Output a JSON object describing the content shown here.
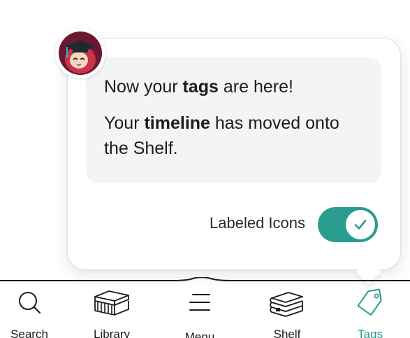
{
  "popover": {
    "line1_prefix": "Now your ",
    "line1_bold": "tags",
    "line1_suffix": " are here!",
    "line2_prefix": "Your ",
    "line2_bold": "timeline",
    "line2_suffix": " has moved onto the Shelf.",
    "toggle_label": "Labeled Icons",
    "toggle_on": true
  },
  "tabs": [
    {
      "id": "search",
      "label": "Search",
      "icon": "search-icon",
      "active": false
    },
    {
      "id": "library",
      "label": "Library",
      "icon": "library-icon",
      "active": false
    },
    {
      "id": "menu",
      "label": "Menu",
      "icon": "menu-icon",
      "active": false
    },
    {
      "id": "shelf",
      "label": "Shelf",
      "icon": "shelf-icon",
      "active": false
    },
    {
      "id": "tags",
      "label": "Tags",
      "icon": "tag-icon",
      "active": true
    }
  ],
  "colors": {
    "accent": "#2a9d8f",
    "avatar_bg": "#6b1830",
    "message_bg": "#f4f4f7"
  }
}
